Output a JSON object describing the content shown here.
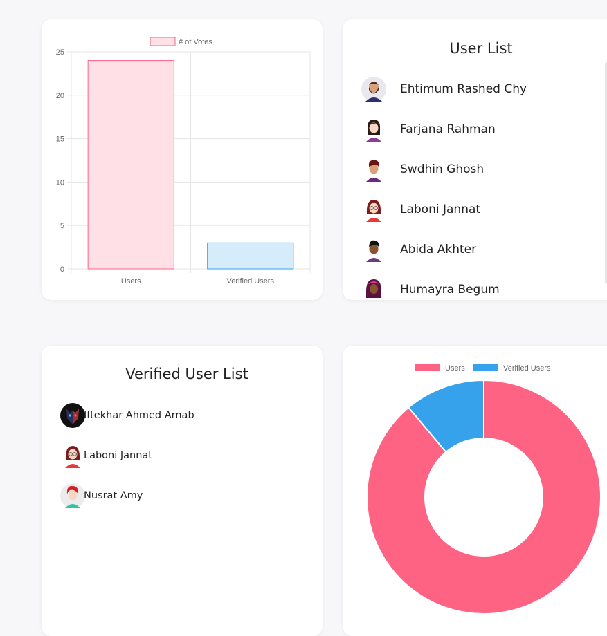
{
  "bar_chart": {
    "chart_data": {
      "type": "bar",
      "categories": [
        "Users",
        "Verified Users"
      ],
      "series": [
        {
          "name": "# of Votes",
          "values": [
            24,
            3
          ]
        }
      ],
      "ylim": [
        0,
        25
      ],
      "yticks": [
        0,
        5,
        10,
        15,
        20,
        25
      ],
      "legend": "top",
      "grid": true,
      "colors": {
        "fill": [
          "#ffe0e6",
          "#d7ecfb"
        ],
        "stroke": [
          "#ff6384",
          "#36a2eb"
        ]
      }
    }
  },
  "user_list": {
    "title": "User List",
    "items": [
      {
        "name": "Ehtimum Rashed Chy",
        "avatar": "man-beard-avatar"
      },
      {
        "name": "Farjana Rahman",
        "avatar": "woman-avatar"
      },
      {
        "name": "Swdhin Ghosh",
        "avatar": "man-avatar"
      },
      {
        "name": "Laboni Jannat",
        "avatar": "woman-glasses-avatar"
      },
      {
        "name": "Abida Akhter",
        "avatar": "woman-dark-avatar"
      },
      {
        "name": "Humayra Begum",
        "avatar": "woman-hijab-avatar"
      }
    ]
  },
  "verified_list": {
    "title": "Verified User List",
    "items": [
      {
        "name": "Iftekhar Ahmed Arnab",
        "avatar": "wolf-avatar"
      },
      {
        "name": "Laboni Jannat",
        "avatar": "woman-glasses-avatar"
      },
      {
        "name": "Nusrat Amy",
        "avatar": "woman-red-hair-avatar"
      }
    ]
  },
  "donut_chart": {
    "chart_data": {
      "type": "pie",
      "categories": [
        "Users",
        "Verified Users"
      ],
      "values": [
        24,
        3
      ],
      "legend": "top",
      "colors": [
        "#ff6384",
        "#36a2eb"
      ]
    }
  }
}
